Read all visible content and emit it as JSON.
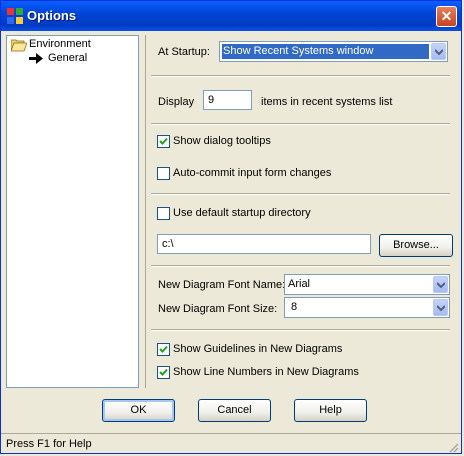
{
  "window": {
    "title": "Options",
    "close_glyph": "✕"
  },
  "tree": {
    "root": {
      "label": "Environment",
      "icon": "open-folder-icon"
    },
    "child": {
      "label": "General",
      "icon": "arrow-right-icon"
    }
  },
  "startup": {
    "label": "At Startup:",
    "selected": "Show Recent Systems window"
  },
  "display": {
    "label": "Display",
    "value": "9",
    "suffix": "items in recent systems list"
  },
  "options": {
    "show_tooltips": {
      "label": "Show dialog tooltips",
      "checked": true
    },
    "auto_commit": {
      "label": "Auto-commit input form changes",
      "checked": false
    },
    "default_dir": {
      "label": "Use default startup directory",
      "checked": false
    }
  },
  "directory": {
    "value": "c:\\",
    "browse_label": "Browse..."
  },
  "font": {
    "name_label": "New Diagram Font Name:",
    "name_value": "Arial",
    "size_label": "New Diagram Font Size:",
    "size_value": "8"
  },
  "diagram": {
    "guidelines": {
      "label": "Show Guidelines in New Diagrams",
      "checked": true
    },
    "line_numbers": {
      "label": "Show Line Numbers in New Diagrams",
      "checked": true
    }
  },
  "buttons": {
    "ok": "OK",
    "cancel": "Cancel",
    "help": "Help"
  },
  "status": {
    "text": "Press F1 for Help"
  },
  "colors": {
    "title_bar": "#0054e3",
    "selection": "#316ac5",
    "face": "#ece9d8"
  }
}
